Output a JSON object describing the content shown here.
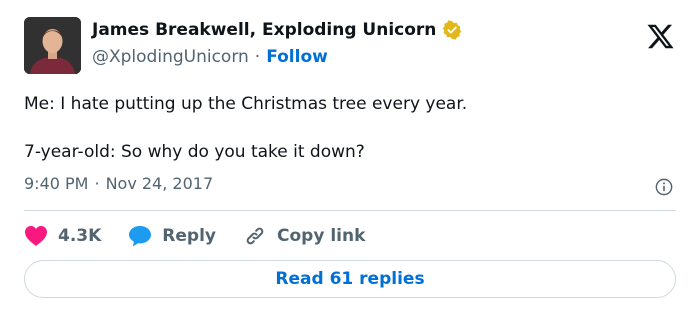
{
  "author": {
    "name": "James Breakwell, Exploding Unicorn",
    "handle": "@XplodingUnicorn",
    "separator": "·",
    "follow_label": "Follow"
  },
  "tweet": {
    "line1": "Me: I hate putting up the Christmas tree every year.",
    "line2": "7-year-old: So why do you take it down?",
    "time": "9:40 PM",
    "separator": "·",
    "date": "Nov 24, 2017"
  },
  "actions": {
    "likes": "4.3K",
    "reply_label": "Reply",
    "copy_label": "Copy link"
  },
  "read_replies_label": "Read 61 replies",
  "colors": {
    "link": "#006fd6",
    "heart": "#f91880",
    "reply_bubble": "#1d9bf0",
    "verified": "#e2b719",
    "secondary_text": "#536471",
    "border": "#cfd9de"
  },
  "icons": [
    "avatar",
    "verified-badge-icon",
    "x-logo-icon",
    "info-icon",
    "heart-icon",
    "reply-bubble-icon",
    "link-icon"
  ]
}
